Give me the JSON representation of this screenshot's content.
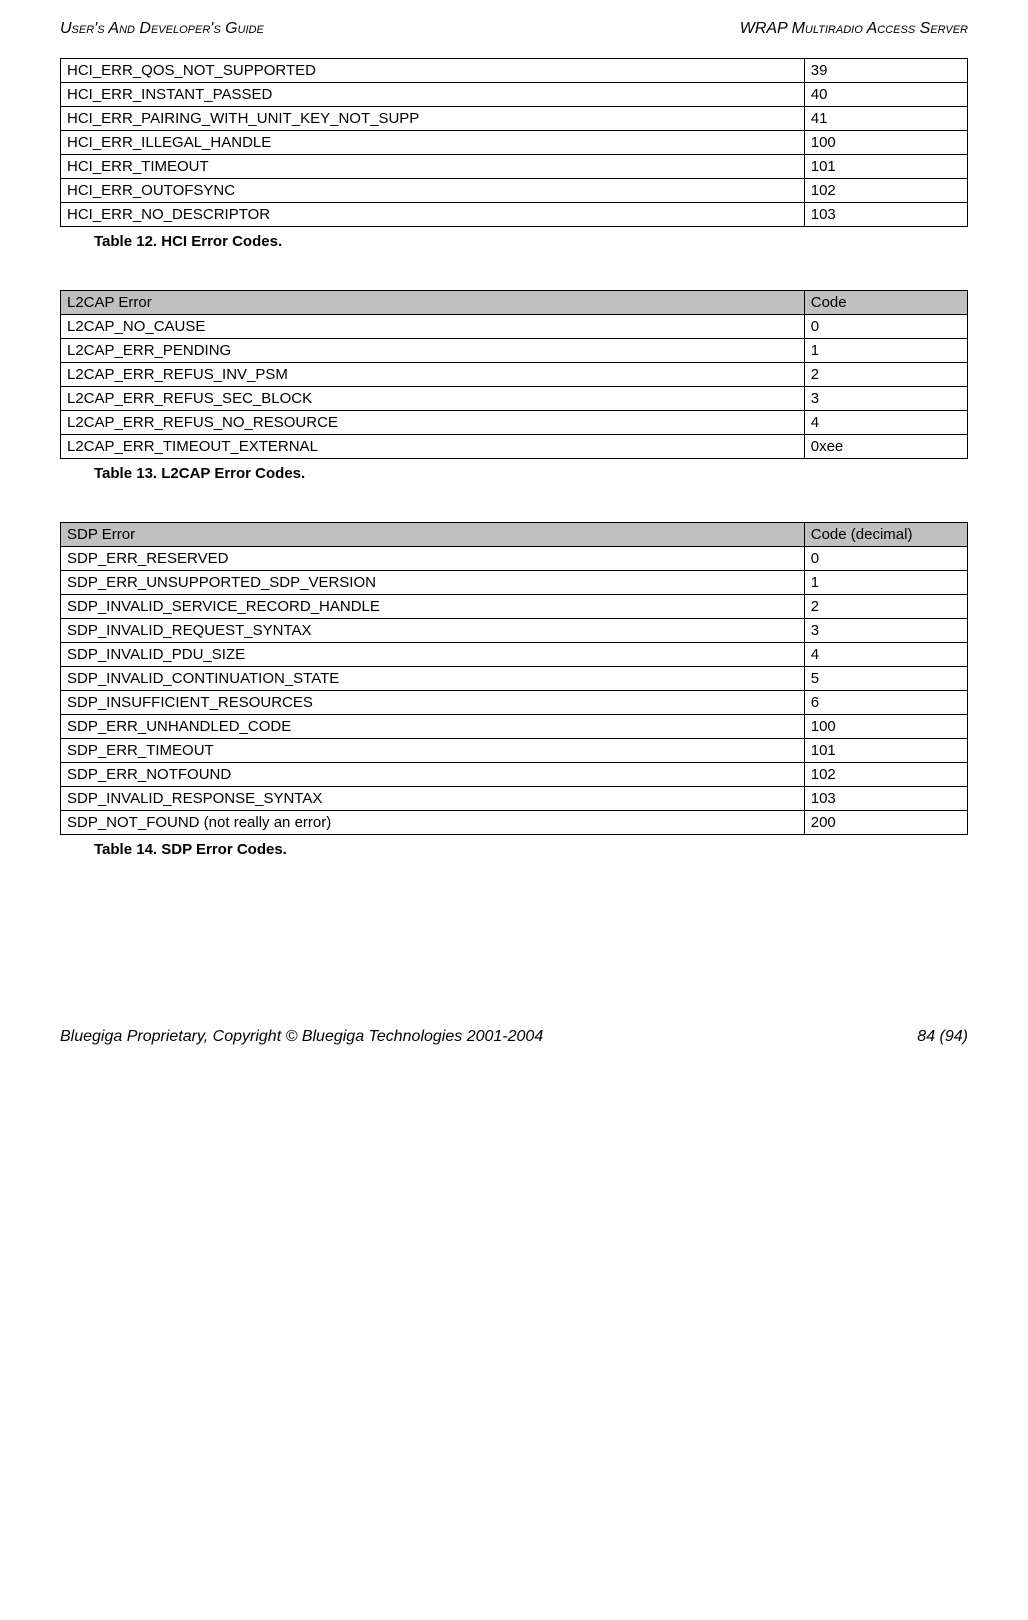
{
  "header": {
    "left": "User's And Developer's Guide",
    "right": "WRAP Multiradio Access Server"
  },
  "table12": {
    "rows": [
      {
        "name": "HCI_ERR_QOS_NOT_SUPPORTED",
        "code": "39"
      },
      {
        "name": "HCI_ERR_INSTANT_PASSED",
        "code": "40"
      },
      {
        "name": "HCI_ERR_PAIRING_WITH_UNIT_KEY_NOT_SUPP",
        "code": "41"
      },
      {
        "name": "HCI_ERR_ILLEGAL_HANDLE",
        "code": "100"
      },
      {
        "name": "HCI_ERR_TIMEOUT",
        "code": "101"
      },
      {
        "name": "HCI_ERR_OUTOFSYNC",
        "code": "102"
      },
      {
        "name": "HCI_ERR_NO_DESCRIPTOR",
        "code": "103"
      }
    ]
  },
  "caption12": "Table 12. HCI Error Codes.",
  "table13": {
    "header": {
      "c1": "L2CAP Error",
      "c2": "Code"
    },
    "rows": [
      {
        "name": "L2CAP_NO_CAUSE",
        "code": "0"
      },
      {
        "name": "L2CAP_ERR_PENDING",
        "code": "1"
      },
      {
        "name": "L2CAP_ERR_REFUS_INV_PSM",
        "code": "2"
      },
      {
        "name": "L2CAP_ERR_REFUS_SEC_BLOCK",
        "code": "3"
      },
      {
        "name": "L2CAP_ERR_REFUS_NO_RESOURCE",
        "code": "4"
      },
      {
        "name": "L2CAP_ERR_TIMEOUT_EXTERNAL",
        "code": "0xee"
      }
    ]
  },
  "caption13": "Table 13. L2CAP Error Codes.",
  "table14": {
    "header": {
      "c1": "SDP Error",
      "c2": "Code (decimal)"
    },
    "rows": [
      {
        "name": "SDP_ERR_RESERVED",
        "code": "0"
      },
      {
        "name": "SDP_ERR_UNSUPPORTED_SDP_VERSION",
        "code": "1"
      },
      {
        "name": "SDP_INVALID_SERVICE_RECORD_HANDLE",
        "code": "2"
      },
      {
        "name": "SDP_INVALID_REQUEST_SYNTAX",
        "code": "3"
      },
      {
        "name": "SDP_INVALID_PDU_SIZE",
        "code": "4"
      },
      {
        "name": "SDP_INVALID_CONTINUATION_STATE",
        "code": "5"
      },
      {
        "name": "SDP_INSUFFICIENT_RESOURCES",
        "code": "6"
      },
      {
        "name": "SDP_ERR_UNHANDLED_CODE",
        "code": "100"
      },
      {
        "name": "SDP_ERR_TIMEOUT",
        "code": "101"
      },
      {
        "name": "SDP_ERR_NOTFOUND",
        "code": "102"
      },
      {
        "name": "SDP_INVALID_RESPONSE_SYNTAX",
        "code": "103"
      },
      {
        "name": "SDP_NOT_FOUND (not really an error)",
        "code": "200"
      }
    ]
  },
  "caption14": "Table 14. SDP Error Codes.",
  "footer": {
    "left": "Bluegiga Proprietary, Copyright © Bluegiga Technologies 2001-2004",
    "right": "84 (94)"
  }
}
